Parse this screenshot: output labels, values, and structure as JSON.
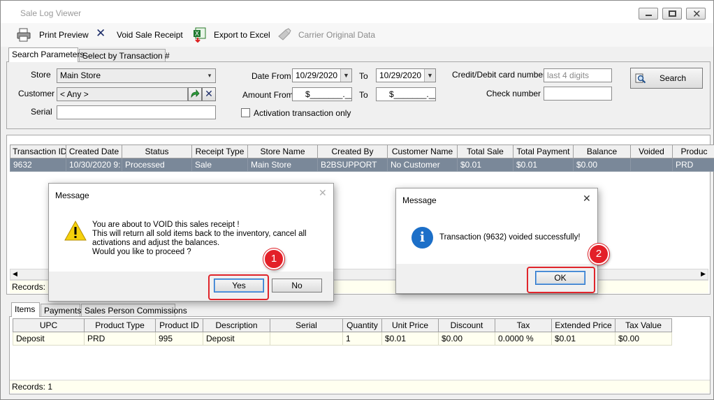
{
  "window": {
    "title": "Sale Log Viewer"
  },
  "toolbar": {
    "print_preview": "Print Preview",
    "void_receipt": "Void Sale Receipt",
    "export_excel": "Export to Excel",
    "carrier_data": "Carrier Original Data"
  },
  "search_tabs": [
    "Search Parameters",
    "Select by Transaction #"
  ],
  "search": {
    "store_label": "Store",
    "store_value": "Main Store",
    "customer_label": "Customer",
    "customer_value": "< Any >",
    "serial_label": "Serial",
    "serial_value": "",
    "date_from_label": "Date From",
    "date_from": "10/29/2020",
    "to_label": "To",
    "date_to": "10/29/2020",
    "amount_from_label": "Amount From",
    "amount_from": "$_______.__",
    "amount_to": "$_______.__",
    "activation_only_label": "Activation transaction only",
    "card_label": "Credit/Debit card number",
    "card_placeholder": "last 4 digits",
    "check_label": "Check number",
    "check_value": "",
    "search_button": "Search"
  },
  "transactions": {
    "columns": [
      "Transaction ID",
      "Created Date",
      "Status",
      "Receipt Type",
      "Store Name",
      "Created By",
      "Customer Name",
      "Total Sale",
      "Total Payment",
      "Balance",
      "Voided",
      "Produc"
    ],
    "rows": [
      [
        "9632",
        "10/30/2020 9:",
        "Processed",
        "Sale",
        "Main Store",
        "B2BSUPPORT",
        "No Customer",
        "$0.01",
        "$0.01",
        "$0.00",
        "",
        "PRD"
      ]
    ],
    "records": "Records: 1"
  },
  "detail_tabs": [
    "Items",
    "Payments",
    "Sales Person Commissions"
  ],
  "items": {
    "columns": [
      "UPC",
      "Product Type",
      "Product ID",
      "Description",
      "Serial",
      "Quantity",
      "Unit Price",
      "Discount",
      "Tax",
      "Extended Price",
      "Tax Value"
    ],
    "rows": [
      [
        "Deposit",
        "PRD",
        "995",
        "Deposit",
        "",
        "1",
        "$0.01",
        "$0.00",
        "0.0000 %",
        "$0.01",
        "$0.00"
      ]
    ],
    "records": "Records: 1"
  },
  "confirm_dialog": {
    "title": "Message",
    "line1": "You are about to VOID this sales receipt !",
    "line2": "This will return all sold items back to the inventory, cancel all",
    "line3": "activations and adjust the balances.",
    "line4": "Would you like to proceed ?",
    "yes": "Yes",
    "no": "No",
    "callout": "1"
  },
  "info_dialog": {
    "title": "Message",
    "text": "Transaction (9632) voided successfully!",
    "ok": "OK",
    "callout": "2"
  },
  "colors": {
    "selected_row": "#7a8899",
    "callout": "#e32028",
    "info_icon": "#1c6fc8",
    "warning_icon": "#f5d10c"
  }
}
